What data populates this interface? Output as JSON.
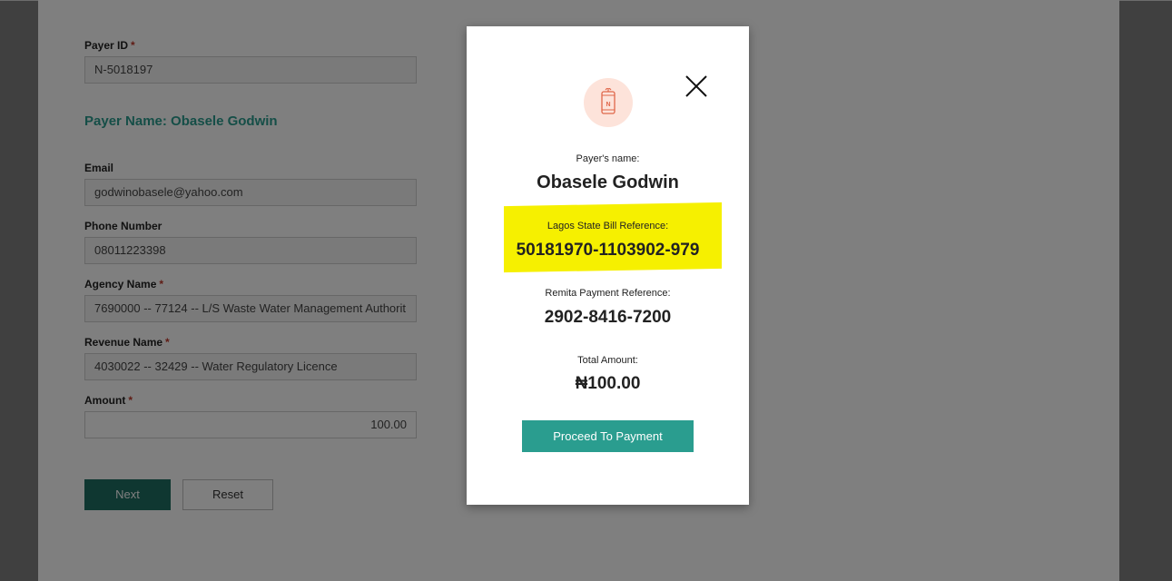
{
  "form": {
    "payer_id": {
      "label": "Payer ID",
      "required": "*",
      "value": "N-5018197"
    },
    "payer_name_heading": "Payer Name: Obasele Godwin",
    "email": {
      "label": "Email",
      "value": "godwinobasele@yahoo.com"
    },
    "phone": {
      "label": "Phone Number",
      "value": "08011223398"
    },
    "agency": {
      "label": "Agency Name",
      "required": "*",
      "value": "7690000 -- 77124 -- L/S Waste Water Management Authorit"
    },
    "revenue": {
      "label": "Revenue Name",
      "required": "*",
      "value": "4030022 -- 32429 -- Water Regulatory Licence"
    },
    "amount": {
      "label": "Amount",
      "required": "*",
      "value": "100.00"
    },
    "next_label": "Next",
    "reset_label": "Reset"
  },
  "modal": {
    "icon": "mobile-naira-icon",
    "icon_letter": "N",
    "close_icon": "close-icon",
    "payer_name_label": "Payer's name:",
    "payer_name": "Obasele Godwin",
    "bill_ref_label": "Lagos State Bill Reference:",
    "bill_ref": "50181970-1103902-979",
    "remita_ref_label": "Remita Payment Reference:",
    "remita_ref": "2902-8416-7200",
    "total_label": "Total Amount:",
    "total": "₦100.00",
    "proceed_label": "Proceed To Payment"
  },
  "colors": {
    "accent": "#2a9d8f",
    "next_button": "#1f6e62",
    "highlight": "#f6f000",
    "icon_bg": "#fde3da",
    "icon_stroke": "#e0674a"
  }
}
